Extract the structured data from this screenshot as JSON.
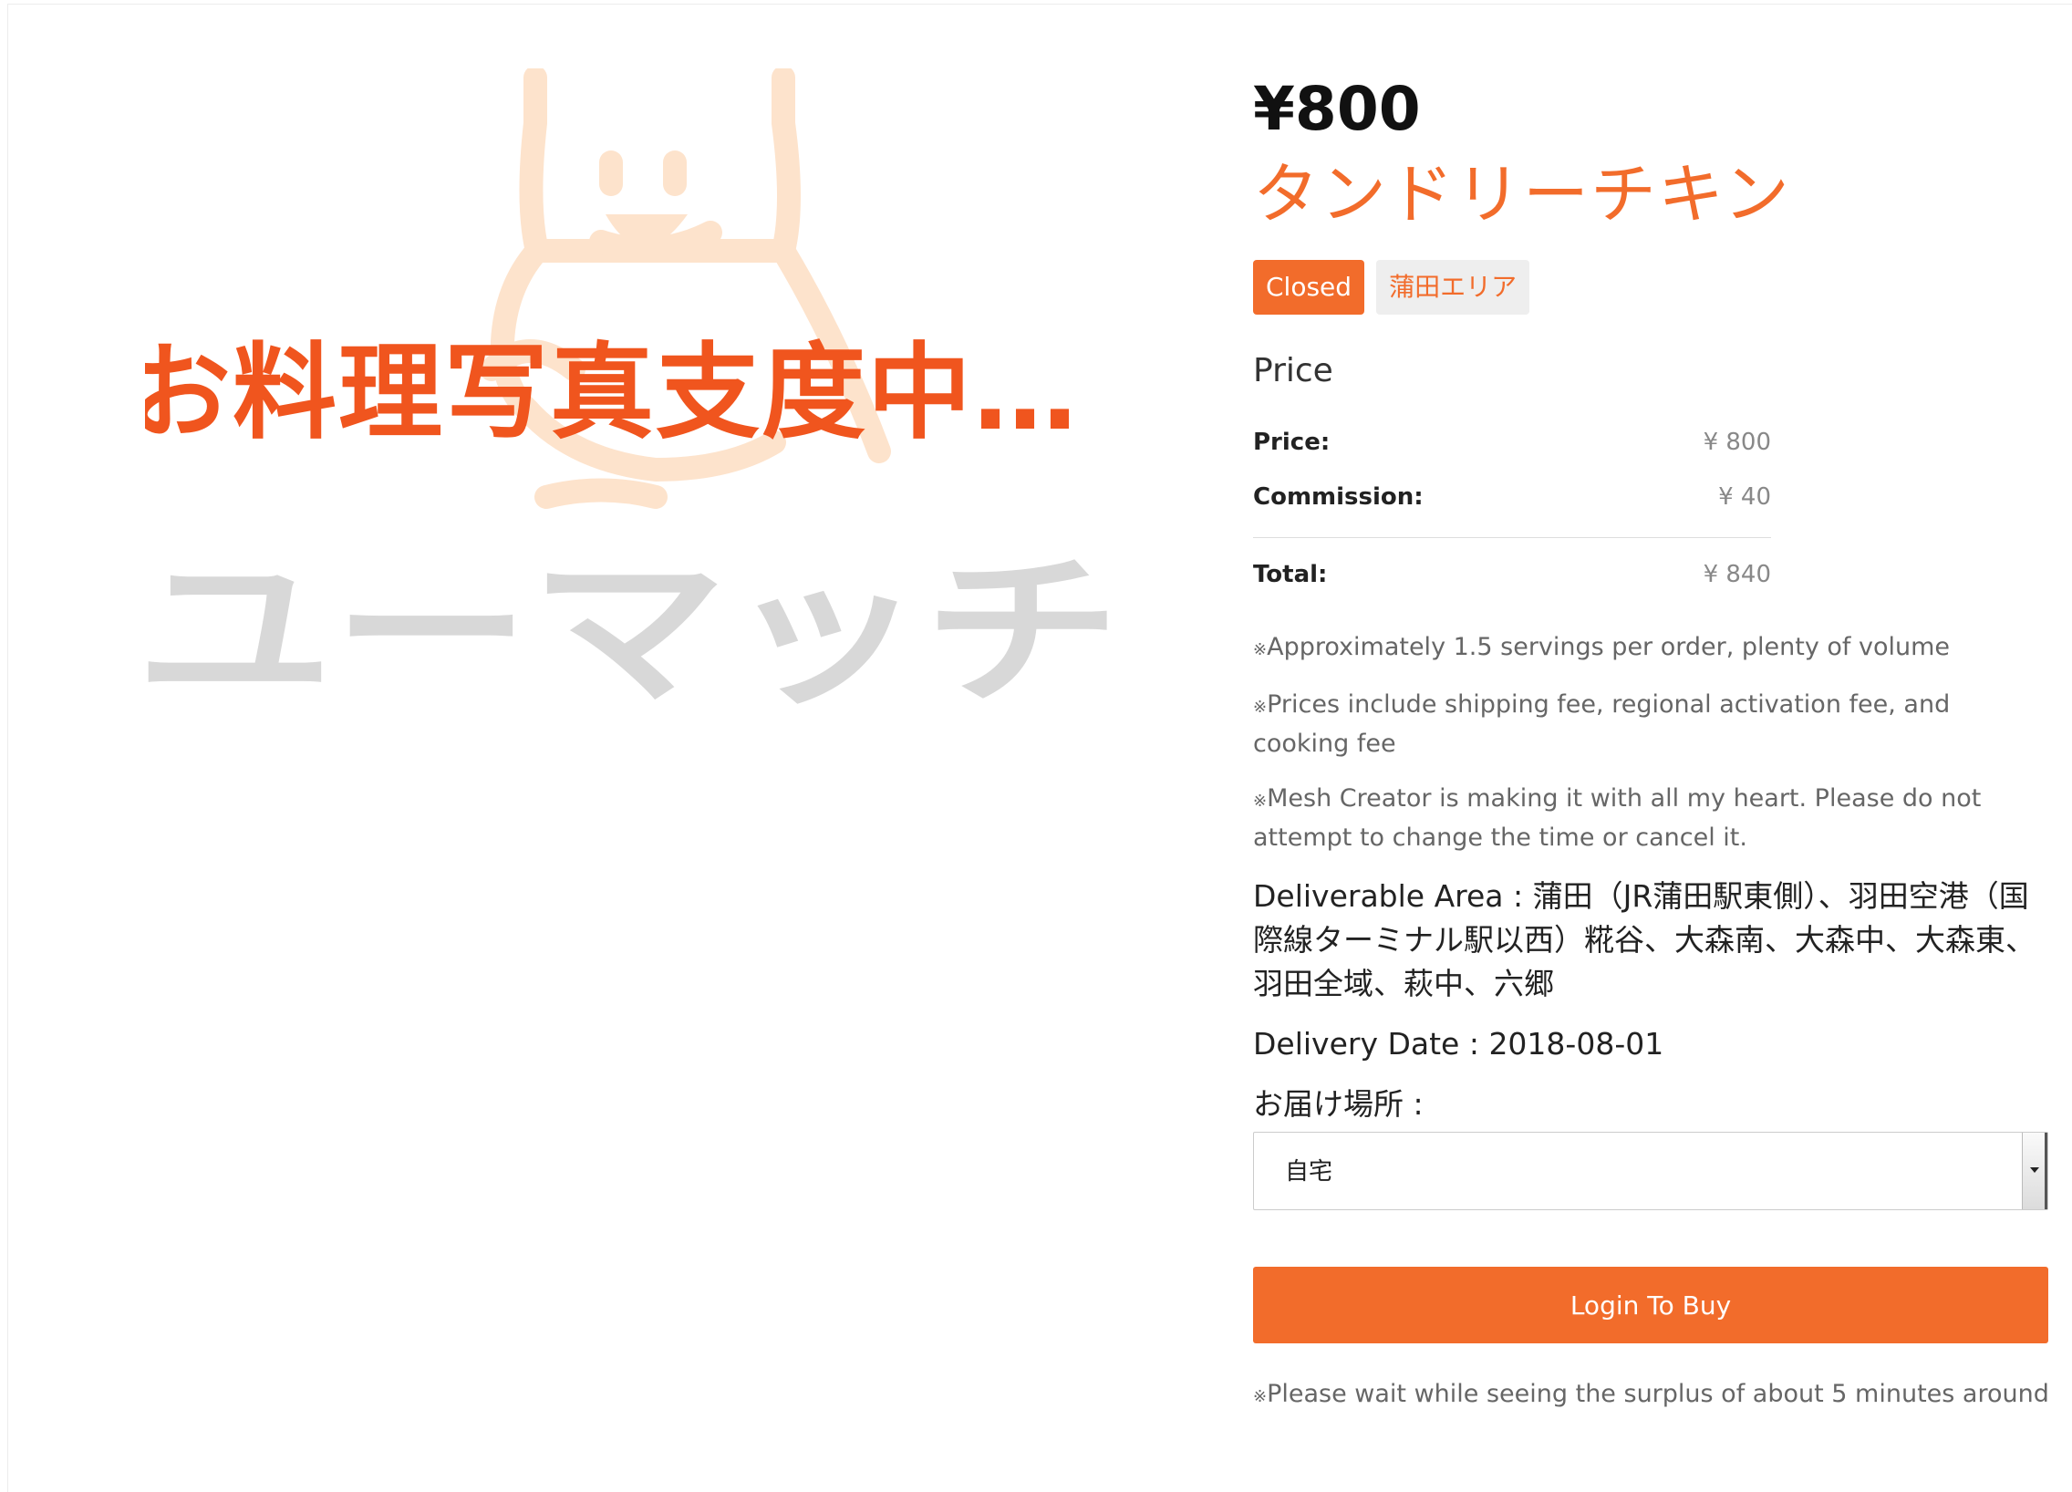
{
  "product": {
    "price": "¥800",
    "name": "タンドリーチキン",
    "image_caption": "お料理写真支度中…",
    "image_logo_text": "ユーマッチ",
    "tags": {
      "status": "Closed",
      "area": "蒲田エリア"
    }
  },
  "price_section": {
    "title": "Price",
    "rows": [
      {
        "label": "Price:",
        "value": "¥ 800"
      },
      {
        "label": "Commission:",
        "value": "¥ 40"
      }
    ],
    "total": {
      "label": "Total:",
      "value": "¥ 840"
    }
  },
  "notes": {
    "mark": "※",
    "items": [
      "Approximately 1.5 servings per order, plenty of volume",
      "Prices include shipping fee, regional activation fee, and cooking fee",
      "Mesh Creator is making it with all my heart. Please do not attempt to change the time or cancel it."
    ],
    "after_button": "Please wait while seeing the surplus of about 5 minutes around"
  },
  "delivery": {
    "area_text": "Deliverable Area : 蒲田（JR蒲田駅東側）、羽田空港（国際線ターミナル駅以西）糀谷、大森南、大森中、大森東、羽田全域、萩中、六郷",
    "date_text": "Delivery Date : 2018-08-01",
    "location_label": "お届け場所 :",
    "location_selected": "自宅"
  },
  "actions": {
    "buy_label": "Login To Buy"
  },
  "colors": {
    "accent": "#f26c2b",
    "mascot": "#fde3cc",
    "logo_gray": "#d8d8d8"
  }
}
